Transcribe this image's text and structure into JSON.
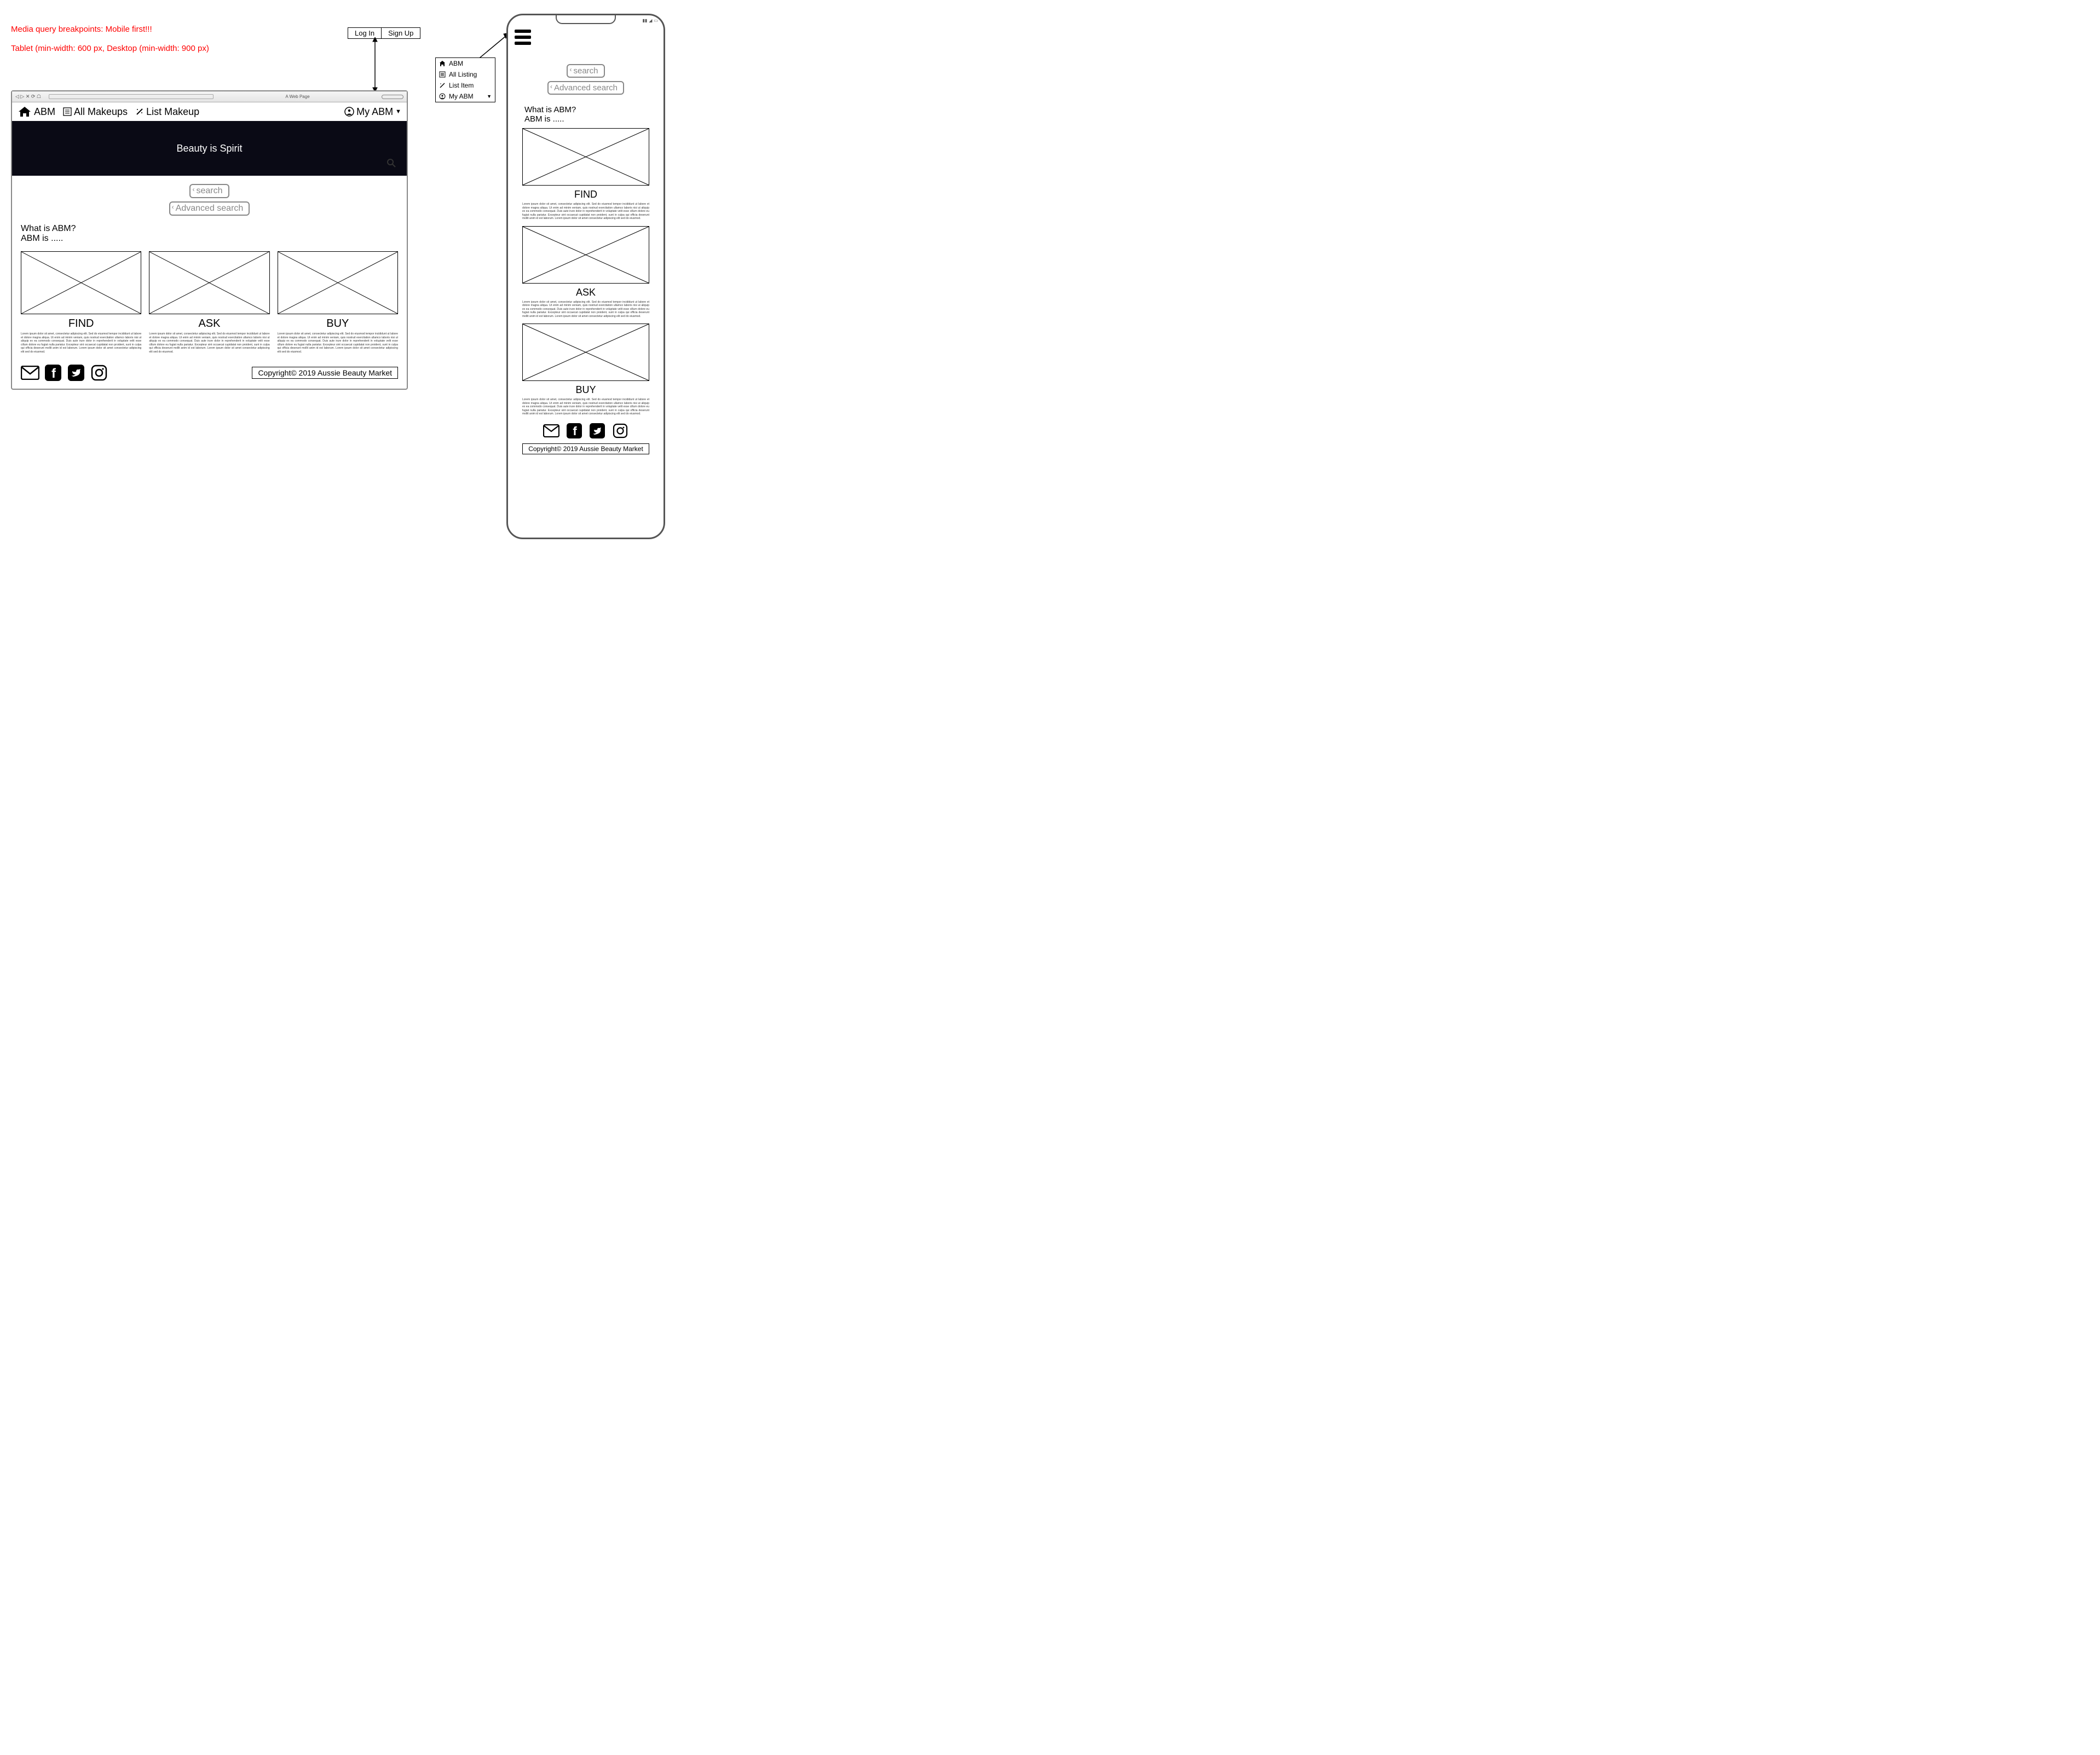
{
  "annotations": {
    "line1": "Media query breakpoints: Mobile first!!!",
    "line2": "Tablet (min-width: 600 px, Desktop (min-width: 900 px)"
  },
  "auth": {
    "login": "Log In",
    "signup": "Sign Up"
  },
  "browser": {
    "title": "A Web Page"
  },
  "navbar": {
    "brand": "ABM",
    "all": "All Makeups",
    "list": "List Makeup",
    "account": "My ABM"
  },
  "hero": {
    "tagline": "Beauty is Spirit"
  },
  "search": {
    "placeholder": "search",
    "advanced": "Advanced search"
  },
  "intro": {
    "heading": "What is ABM?",
    "body": "ABM is ....."
  },
  "features": [
    {
      "title": "FIND"
    },
    {
      "title": "ASK"
    },
    {
      "title": "BUY"
    }
  ],
  "footer": {
    "copyright": "Copyright© 2019 Aussie Beauty Market"
  },
  "menubox": {
    "home": "ABM",
    "all": "All Listing",
    "list": "List Item",
    "account": "My ABM"
  },
  "lorem": "Lorem ipsum dolor sit amet, consectetur adipiscing elit. Sed do eiusmod tempor incididunt ut labore et dolore magna aliqua. Ut enim ad minim veniam, quis nostrud exercitation ullamco laboris nisi ut aliquip ex ea commodo consequat. Duis aute irure dolor in reprehenderit in voluptate velit esse cillum dolore eu fugiat nulla pariatur. Excepteur sint occaecat cupidatat non proident, sunt in culpa qui officia deserunt mollit anim id est laborum. Lorem ipsum dolor sit amet consectetur adipiscing elit sed do eiusmod."
}
